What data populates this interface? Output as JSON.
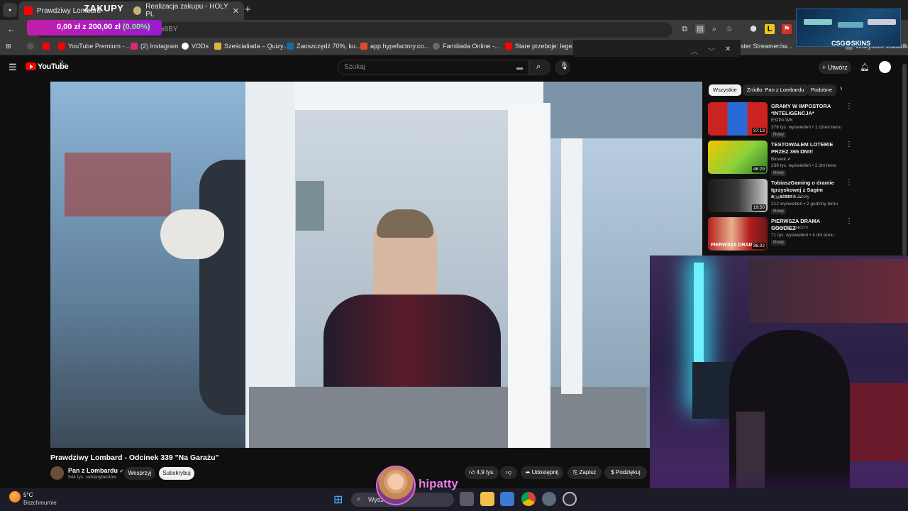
{
  "browser": {
    "tabs": [
      {
        "label": "Prawdziwy Lombard",
        "active": true
      },
      {
        "label": "Realizacja zakupu - HOLY PL",
        "active": false
      }
    ],
    "url": "youtube.com/watch?v=…Tx8BY",
    "bookmarks": [
      "YouTube Premium -...",
      "(2) Instagram",
      "VODs",
      "Sześcialiada – Quizy...",
      "Zaoszczędź 70%, ku...",
      "app.hypefactory.co...",
      "Familiada Online -...",
      "Stare przeboje: lege...",
      "ster Streamerów...",
      "Wszystkie zakładki"
    ],
    "accent_color": "#ff0000"
  },
  "overlay": {
    "zakupy_title": "ZAKUPY",
    "amount": "0,00 zł",
    "separator": "z",
    "goal": "200,00 zł",
    "percent": "(0.00%)",
    "csg_label": "CSG⚙SKINS",
    "streamer_name": "hipatty"
  },
  "youtube": {
    "logo": "YouTube",
    "region": "PL",
    "search_placeholder": "Szukaj",
    "create_label": "Utwórz",
    "video": {
      "title": "Prawdziwy Lombard - Odcinek 339 \"Na Garażu\"",
      "channel": "Pan z Lombardu",
      "subscribers": "544 tys. subskrybentów",
      "support": "Wesprzyj",
      "subscribe": "Subskrybuj",
      "likes": "4,9 tys.",
      "share": "Udostępnij",
      "save": "Zapisz",
      "thanks": "Podziękuj"
    },
    "chips": [
      "Wszystkie",
      "Źródło: Pan z Lombardu",
      "Podobne"
    ],
    "recommendations": [
      {
        "title": "GRAMY W IMPOSTORA *INTELIGENCJA*",
        "channel": "EKIPA WK",
        "meta": "378 tys. wyświetleń • 1 dzień temu",
        "badge": "Nowy",
        "duration": "37:13"
      },
      {
        "title": "TESTOWAŁEM LOTERIE PRZEZ 365 DNI!!",
        "channel": "Blowek",
        "meta": "239 tys. wyświetleń • 2 dni temu",
        "badge": "Nowy",
        "duration": "46:29"
      },
      {
        "title": "TobiaszGaming o dramie Igrzyskowej z Sagim e__s!em i ...",
        "channel": "Anarchiczne Szoty",
        "meta": "212 wyświetleń • 2 godziny temu",
        "badge": "Nowy",
        "duration": "19:50"
      },
      {
        "title": "PIERWSZA DRAMA GOODIEZ",
        "channel": "SERHITO SHOTY",
        "meta": "71 tys. wyświetleń • 4 dni temu",
        "badge": "Nowy",
        "duration": "36:02",
        "thumb_caption": "PIERWSZA DRAMA"
      }
    ]
  },
  "taskbar": {
    "temperature": "5°C",
    "weather": "Bezchmurnie",
    "search_placeholder": "Wyszukaj"
  }
}
